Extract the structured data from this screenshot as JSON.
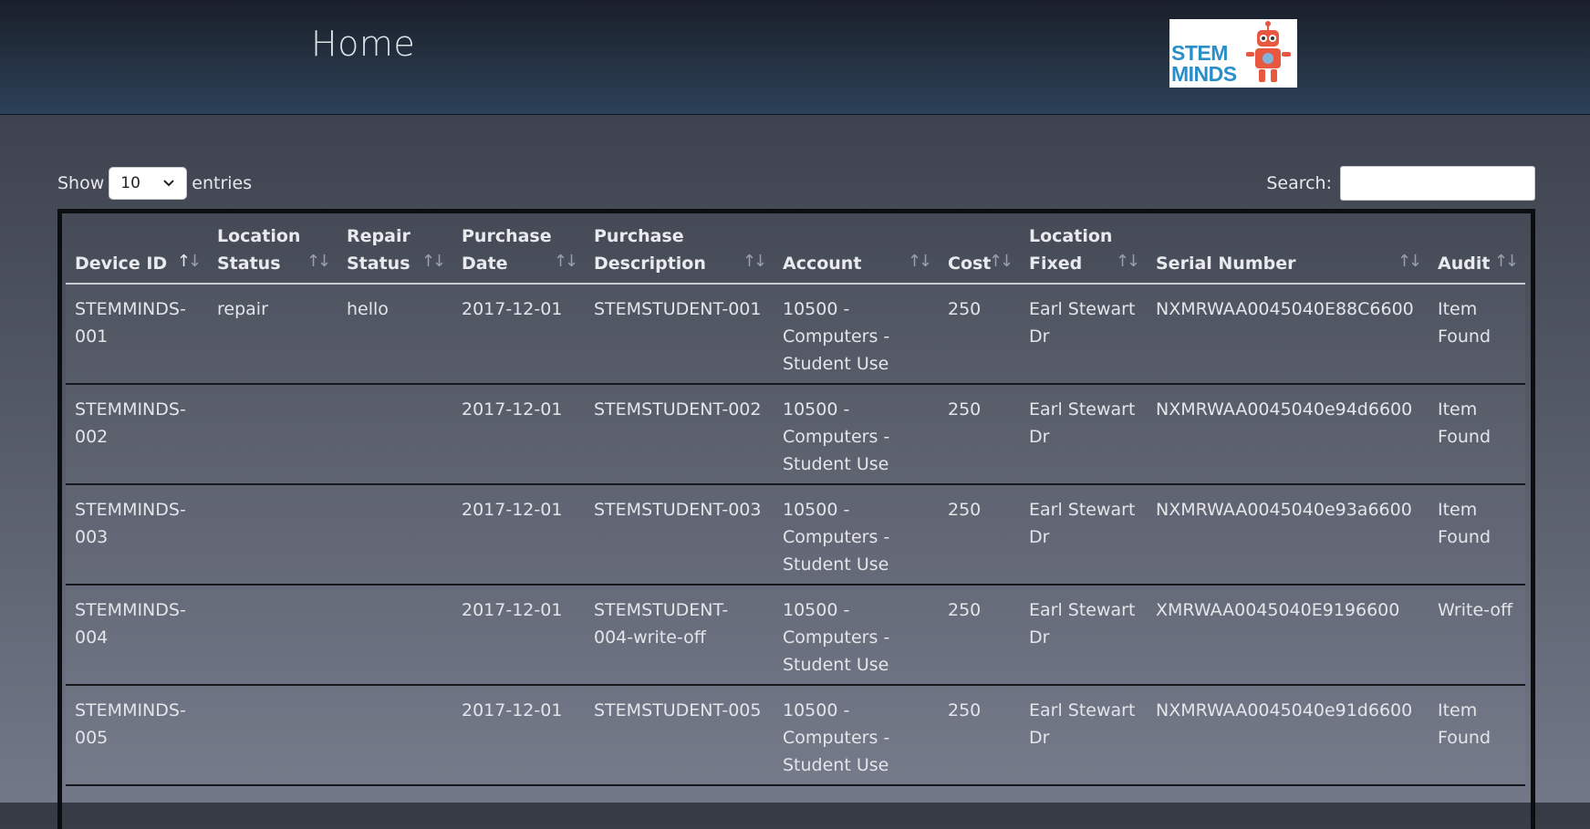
{
  "header": {
    "title": "Home",
    "logo_line1": "STEM",
    "logo_line2": "MINDS"
  },
  "controls": {
    "show_label": "Show",
    "entries_value": "10",
    "entries_label": "entries",
    "search_label": "Search:",
    "search_value": ""
  },
  "table": {
    "columns": [
      "Device ID",
      "Location Status",
      "Repair Status",
      "Purchase Date",
      "Purchase Description",
      "Account",
      "Cost",
      "Location Fixed",
      "Serial Number",
      "Audit"
    ],
    "rows": [
      [
        "STEMMINDS-001",
        "repair",
        "hello",
        "2017-12-01",
        "STEMSTUDENT-001",
        "10500 - Computers - Student Use",
        "250",
        "Earl Stewart Dr",
        "NXMRWAA0045040E88C6600",
        "Item Found"
      ],
      [
        "STEMMINDS-002",
        "",
        "",
        "2017-12-01",
        "STEMSTUDENT-002",
        "10500 - Computers - Student Use",
        "250",
        "Earl Stewart Dr",
        "NXMRWAA0045040e94d6600",
        "Item Found"
      ],
      [
        "STEMMINDS-003",
        "",
        "",
        "2017-12-01",
        "STEMSTUDENT-003",
        "10500 - Computers - Student Use",
        "250",
        "Earl Stewart Dr",
        "NXMRWAA0045040e93a6600",
        "Item Found"
      ],
      [
        "STEMMINDS-004",
        "",
        "",
        "2017-12-01",
        "STEMSTUDENT-004-write-off",
        "10500 - Computers - Student Use",
        "250",
        "Earl Stewart Dr",
        "XMRWAA0045040E9196600",
        "Write-off"
      ],
      [
        "STEMMINDS-005",
        "",
        "",
        "2017-12-01",
        "STEMSTUDENT-005",
        "10500 - Computers - Student Use",
        "250",
        "Earl Stewart Dr",
        "NXMRWAA0045040e91d6600",
        "Item Found"
      ]
    ]
  },
  "colors": {
    "header_bg": "#243242",
    "logo_text": "#2a8ec9",
    "robot": "#e8573f"
  }
}
